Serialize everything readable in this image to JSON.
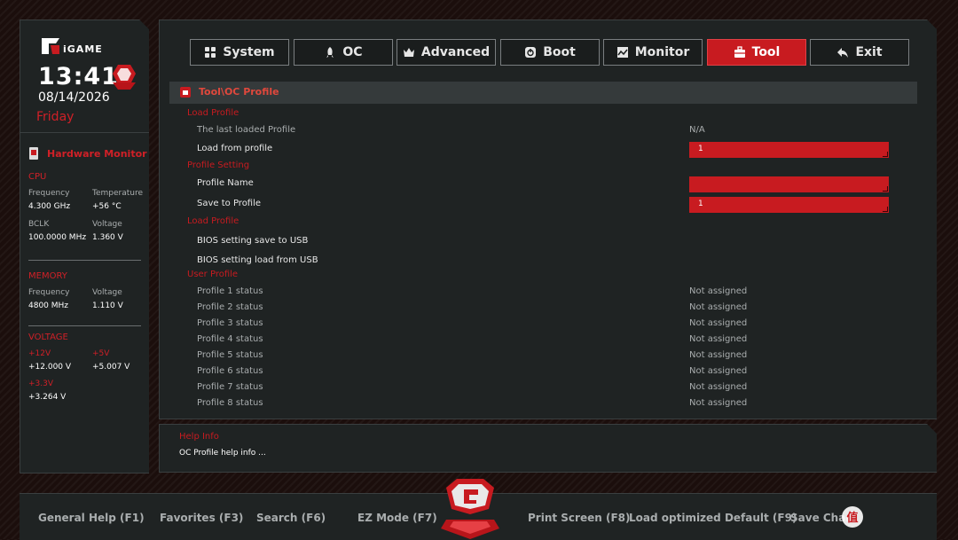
{
  "sidebar": {
    "brand": "iGAME",
    "time": "13:41",
    "date": "08/14/2026",
    "day": "Friday",
    "hardware_monitor_title": "Hardware Monitor",
    "cpu": {
      "title": "CPU",
      "frequency_label": "Frequency",
      "frequency_value": "4.300 GHz",
      "temperature_label": "Temperature",
      "temperature_value": "+56 °C",
      "bclk_label": "BCLK",
      "bclk_value": "100.0000 MHz",
      "voltage_label": "Voltage",
      "voltage_value": "1.360 V"
    },
    "memory": {
      "title": "MEMORY",
      "frequency_label": "Frequency",
      "frequency_value": "4800 MHz",
      "voltage_label": "Voltage",
      "voltage_value": "1.110 V"
    },
    "voltage": {
      "title": "VOLTAGE",
      "v12_label": "+12V",
      "v12_value": "+12.000 V",
      "v5_label": "+5V",
      "v5_value": "+5.007 V",
      "v33_label": "+3.3V",
      "v33_value": "+3.264 V"
    }
  },
  "tabs": [
    {
      "label": "System",
      "icon": "grid-icon"
    },
    {
      "label": "OC",
      "icon": "rocket-icon"
    },
    {
      "label": "Advanced",
      "icon": "crown-icon"
    },
    {
      "label": "Boot",
      "icon": "power-icon"
    },
    {
      "label": "Monitor",
      "icon": "chart-icon"
    },
    {
      "label": "Tool",
      "icon": "toolbox-icon",
      "active": true
    },
    {
      "label": "Exit",
      "icon": "back-arrow-icon"
    }
  ],
  "breadcrumb": "Tool\\OC Profile",
  "content": {
    "group_load_profile": "Load Profile",
    "last_loaded_label": "The last loaded Profile",
    "last_loaded_value": "N/A",
    "load_from_profile_label": "Load from profile",
    "load_from_profile_value": "1",
    "group_profile_setting": "Profile Setting",
    "profile_name_label": "Profile Name",
    "profile_name_value": "",
    "save_to_profile_label": "Save to Profile",
    "save_to_profile_value": "1",
    "group_load_profile_2": "Load Profile",
    "bios_save_usb": "BIOS setting save to USB",
    "bios_load_usb": "BIOS setting load from USB",
    "group_user_profile": "User Profile",
    "profiles": [
      {
        "label": "Profile 1 status",
        "value": "Not assigned"
      },
      {
        "label": "Profile 2 status",
        "value": "Not assigned"
      },
      {
        "label": "Profile 3 status",
        "value": "Not assigned"
      },
      {
        "label": "Profile 4 status",
        "value": "Not assigned"
      },
      {
        "label": "Profile 5 status",
        "value": "Not assigned"
      },
      {
        "label": "Profile 6 status",
        "value": "Not assigned"
      },
      {
        "label": "Profile 7 status",
        "value": "Not assigned"
      },
      {
        "label": "Profile 8 status",
        "value": "Not assigned"
      }
    ]
  },
  "help": {
    "title": "Help Info",
    "text": "OC Profile help info ..."
  },
  "hotkeys": {
    "general_help": "General Help (F1)",
    "favorites": "Favorites (F3)",
    "search": "Search (F6)",
    "ez_mode": "EZ Mode (F7)",
    "print_screen": "Print Screen (F8)",
    "load_defaults": "Load optimized Default (F9)",
    "save_changes": "Save Chan"
  },
  "colors": {
    "accent": "#c81b20",
    "panel": "#1f2323",
    "border": "#3a3f40"
  }
}
